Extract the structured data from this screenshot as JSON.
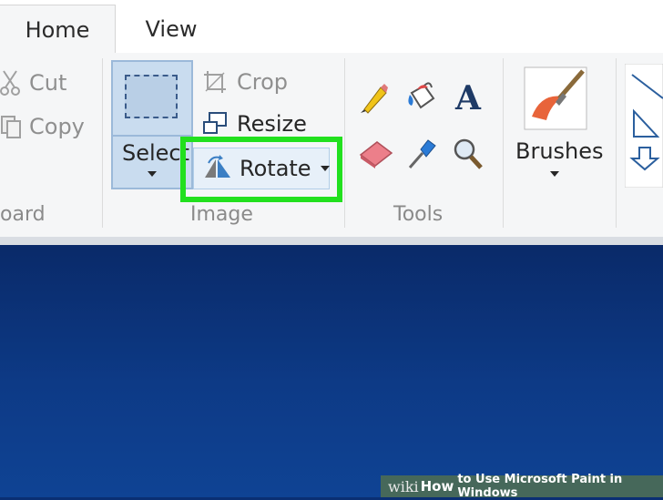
{
  "tabs": [
    {
      "label": "Home"
    },
    {
      "label": "View"
    }
  ],
  "clipboard": {
    "cut_label": "Cut",
    "copy_label": "Copy",
    "group_label": "oard"
  },
  "image": {
    "select_label": "Select",
    "crop_label": "Crop",
    "resize_label": "Resize",
    "rotate_label": "Rotate",
    "group_label": "Image"
  },
  "tools": {
    "group_label": "Tools",
    "items": [
      "pencil-icon",
      "fill-icon",
      "text-icon",
      "eraser-icon",
      "color-picker-icon",
      "magnifier-icon"
    ]
  },
  "brushes": {
    "label": "Brushes"
  },
  "highlight_color": "#22e01e",
  "watermark": {
    "wiki": "wiki",
    "how": "How",
    "rest": "to Use Microsoft Paint in Windows"
  }
}
